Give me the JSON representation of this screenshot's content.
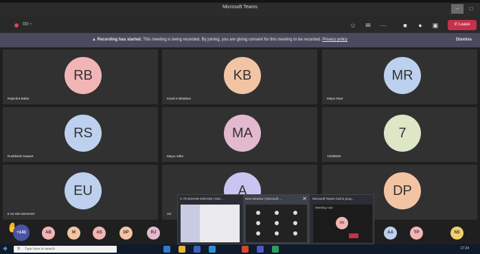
{
  "window": {
    "title": "Microsoft Teams"
  },
  "toolbar": {
    "timer": "00:--",
    "leave_label": "Leave"
  },
  "banner": {
    "bold": "Recording has started.",
    "text": "This meeting is being recorded. By joining, you are giving consent for this meeting to be recorded.",
    "link": "Privacy policy",
    "dismiss": "Dismiss"
  },
  "tiles": [
    {
      "initials": "RB",
      "name": "Rajendra Babar",
      "color": "#f2b5b5"
    },
    {
      "initials": "KB",
      "name": "Kunal K Bhadane",
      "color": "#f3c4a4"
    },
    {
      "initials": "MR",
      "name": "Mayur Raut",
      "color": "#bdd0ee"
    },
    {
      "initials": "RS",
      "name": "Rushikesh Sawant",
      "color": "#bdd0ee"
    },
    {
      "initials": "MA",
      "name": "Mayur Adhe",
      "color": "#e3b9cf"
    },
    {
      "initials": "7",
      "name": "7203903K",
      "color": "#dde6c7"
    },
    {
      "initials": "EU",
      "name": "E 54 OM UDAVANT",
      "color": "#bdd0ee"
    },
    {
      "initials": "A",
      "name": "AG",
      "color": "#c8c6f0"
    },
    {
      "initials": "DP",
      "name": "",
      "color": "#f3c4a4"
    }
  ],
  "tray": {
    "participant_count": "+143",
    "avatars": [
      {
        "initials": "AB",
        "color": "#f2b5b5"
      },
      {
        "initials": "M",
        "color": "#f3c4a4"
      },
      {
        "initials": "AS",
        "color": "#f2b5b5"
      },
      {
        "initials": "DP",
        "color": "#f3c4a4"
      },
      {
        "initials": "RJ",
        "color": "#e3b9cf"
      },
      {
        "initials": "AA",
        "color": "#bdd0ee"
      },
      {
        "initials": "TP",
        "color": "#f2b5b5"
      },
      {
        "initials": "NS",
        "color": "#f0d06e"
      }
    ]
  },
  "thumbnails": [
    {
      "caption": "C-79 SOHAM KOKANE | Micr..."
    },
    {
      "caption": "New Window | Microsoft ..."
    },
    {
      "caption": "Microsoft Teams Call in prog..."
    }
  ],
  "thumb_meeting": {
    "label": "Meeting now",
    "initials": "RB"
  },
  "taskbar": {
    "search_placeholder": "Type here to search",
    "clock": "17:24"
  }
}
